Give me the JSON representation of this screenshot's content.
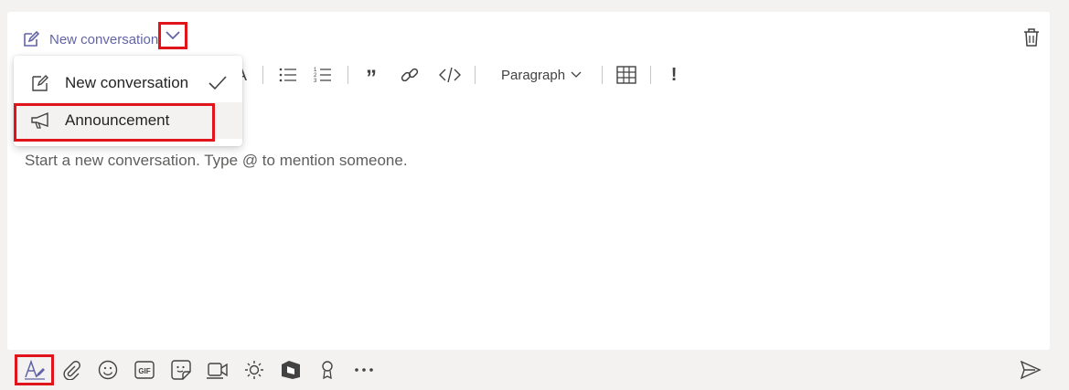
{
  "header": {
    "mode_label": "New conversation",
    "icons": [
      "compose-icon",
      "chevron-down-icon",
      "trash-icon"
    ]
  },
  "toolbar": {
    "paragraph_label": "Paragraph",
    "font_color_glyph": "A",
    "quote_glyph": "”",
    "important_glyph": "!"
  },
  "editor": {
    "placeholder": "Start a new conversation. Type @ to mention someone."
  },
  "dropdown": {
    "items": [
      {
        "label": "New conversation",
        "checked": true
      },
      {
        "label": "Announcement",
        "checked": false
      }
    ]
  },
  "bottom_toolbar": {
    "gif_label": "GIF",
    "icons": [
      "format-icon",
      "attach-icon",
      "emoji-icon",
      "gif-icon",
      "sticker-icon",
      "meet-now-icon",
      "praise-sun-icon",
      "stream-icon",
      "praise-icon",
      "more-icon",
      "send-icon"
    ]
  },
  "colors": {
    "accent": "#6264a7",
    "highlight": "#e0151c",
    "background": "#f3f2f1"
  }
}
